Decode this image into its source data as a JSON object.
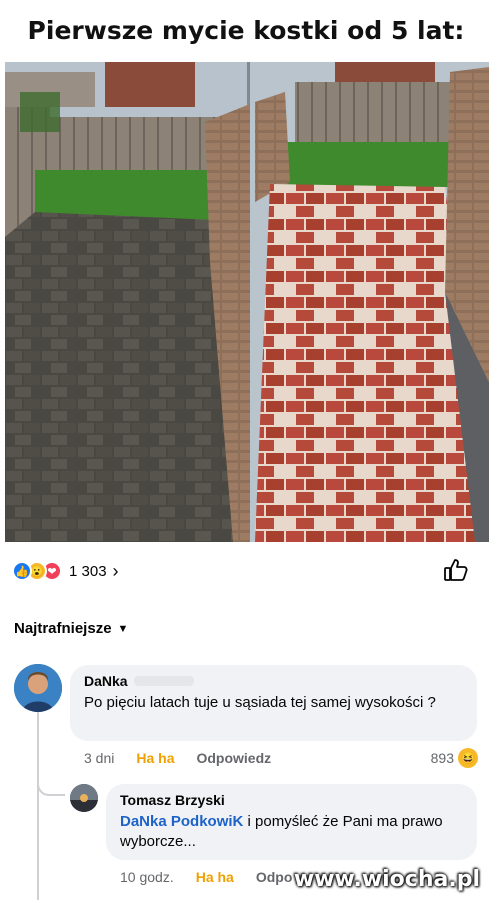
{
  "headline": "Pierwsze mycie kostki od 5 lat:",
  "reactions": {
    "icons": [
      "like-icon",
      "haha-icon",
      "love-icon"
    ],
    "count": "1 303",
    "colors": {
      "like": "#1877f2",
      "haha": "#f7b928",
      "love": "#f33e58"
    }
  },
  "sort_label": "Najtrafniejsze",
  "comments": [
    {
      "author": "DaNka",
      "text": "Po pięciu latach tuje u sąsiada tej samej wysokości ?",
      "time": "3 dni",
      "haha_label": "Ha ha",
      "reply_label": "Odpowiedz",
      "reaction_count": "893"
    },
    {
      "author": "Tomasz Brzyski",
      "mention": "DaNka PodkowiK",
      "text": " i pomyśleć że Pani ma prawo wyborcze...",
      "time": "10 godz.",
      "haha_label": "Ha ha",
      "reply_label": "Odpo"
    }
  ],
  "watermark": "www.wiocha.pl",
  "colors": {
    "mention": "#1d63c8",
    "haha_link": "#f0a000",
    "bubble": "#f0f2f5"
  }
}
